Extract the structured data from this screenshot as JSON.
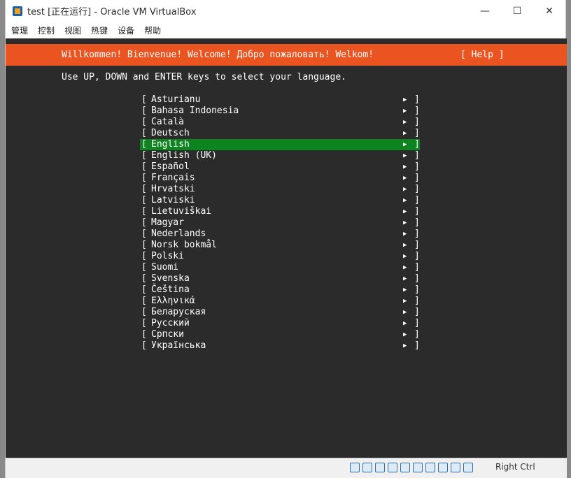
{
  "window": {
    "title": "test [正在运行] - Oracle VM VirtualBox",
    "minimize": "—",
    "maximize": "☐",
    "close": "✕"
  },
  "menu": [
    "管理",
    "控制",
    "视图",
    "热键",
    "设备",
    "帮助"
  ],
  "installer": {
    "welcome": "Willkommen! Bienvenue! Welcome! Добро пожаловать! Welkom!",
    "help": "[ Help ]",
    "instruction": "Use UP, DOWN and ENTER keys to select your language.",
    "languages": [
      "Asturianu",
      "Bahasa Indonesia",
      "Català",
      "Deutsch",
      "English",
      "English (UK)",
      "Español",
      "Français",
      "Hrvatski",
      "Latviski",
      "Lietuviškai",
      "Magyar",
      "Nederlands",
      "Norsk bokmål",
      "Polski",
      "Suomi",
      "Svenska",
      "Čeština",
      "Ελληνικά",
      "Беларуская",
      "Русский",
      "Српски",
      "Українська"
    ],
    "selected_language": "English",
    "bracket_left": "[",
    "bracket_right": "]",
    "arrow": "▶"
  },
  "statusbar": {
    "host_key": "Right Ctrl",
    "icons": [
      "hard-disk-icon",
      "optical-disk-icon",
      "audio-icon",
      "network-icon",
      "usb-icon",
      "shared-folder-icon",
      "display-icon",
      "recording-icon",
      "cpu-icon",
      "mouse-integration-icon"
    ]
  },
  "colors": {
    "header": "#e95420",
    "selection": "#0e8420",
    "screen_bg": "#2b2b2b"
  }
}
